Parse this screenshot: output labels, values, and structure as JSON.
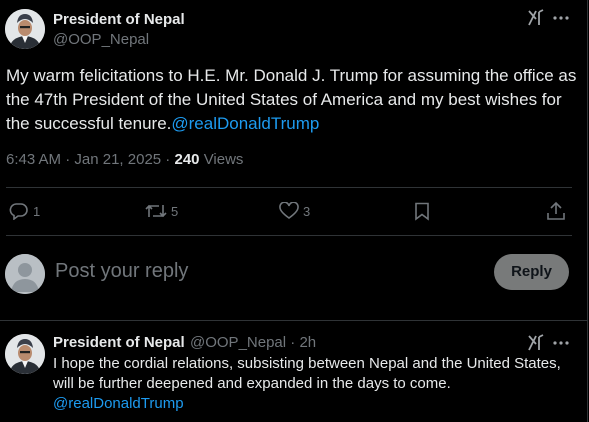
{
  "tweet": {
    "author_name": "President of Nepal",
    "author_handle": "@OOP_Nepal",
    "text": "My warm felicitations to H.E. Mr. Donald J. Trump for assuming the office as the 47th President of the United States of America and my best wishes for the successful tenure.",
    "mention": "@realDonaldTrump",
    "time": "6:43 AM",
    "date": "Jan 21, 2025",
    "views_count": "240",
    "views_label": "Views",
    "replies": "1",
    "reposts": "5",
    "likes": "3"
  },
  "reply_box": {
    "placeholder": "Post your reply",
    "button_label": "Reply"
  },
  "thread_reply": {
    "author_name": "President of Nepal",
    "author_handle": "@OOP_Nepal",
    "age": "2h",
    "text": "I hope the cordial relations, subsisting between Nepal and the United States, will be further deepened and expanded in the days to come.",
    "mention": "@realDonaldTrump"
  },
  "icons": [
    "grok-icon",
    "more-icon",
    "reply-icon",
    "repost-icon",
    "like-icon",
    "bookmark-icon",
    "share-icon"
  ],
  "colors": {
    "background": "#000000",
    "text": "#e7e9ea",
    "muted": "#71767b",
    "link": "#1d9bf0",
    "border": "#2f3336",
    "reply_button": "#787a7a"
  }
}
